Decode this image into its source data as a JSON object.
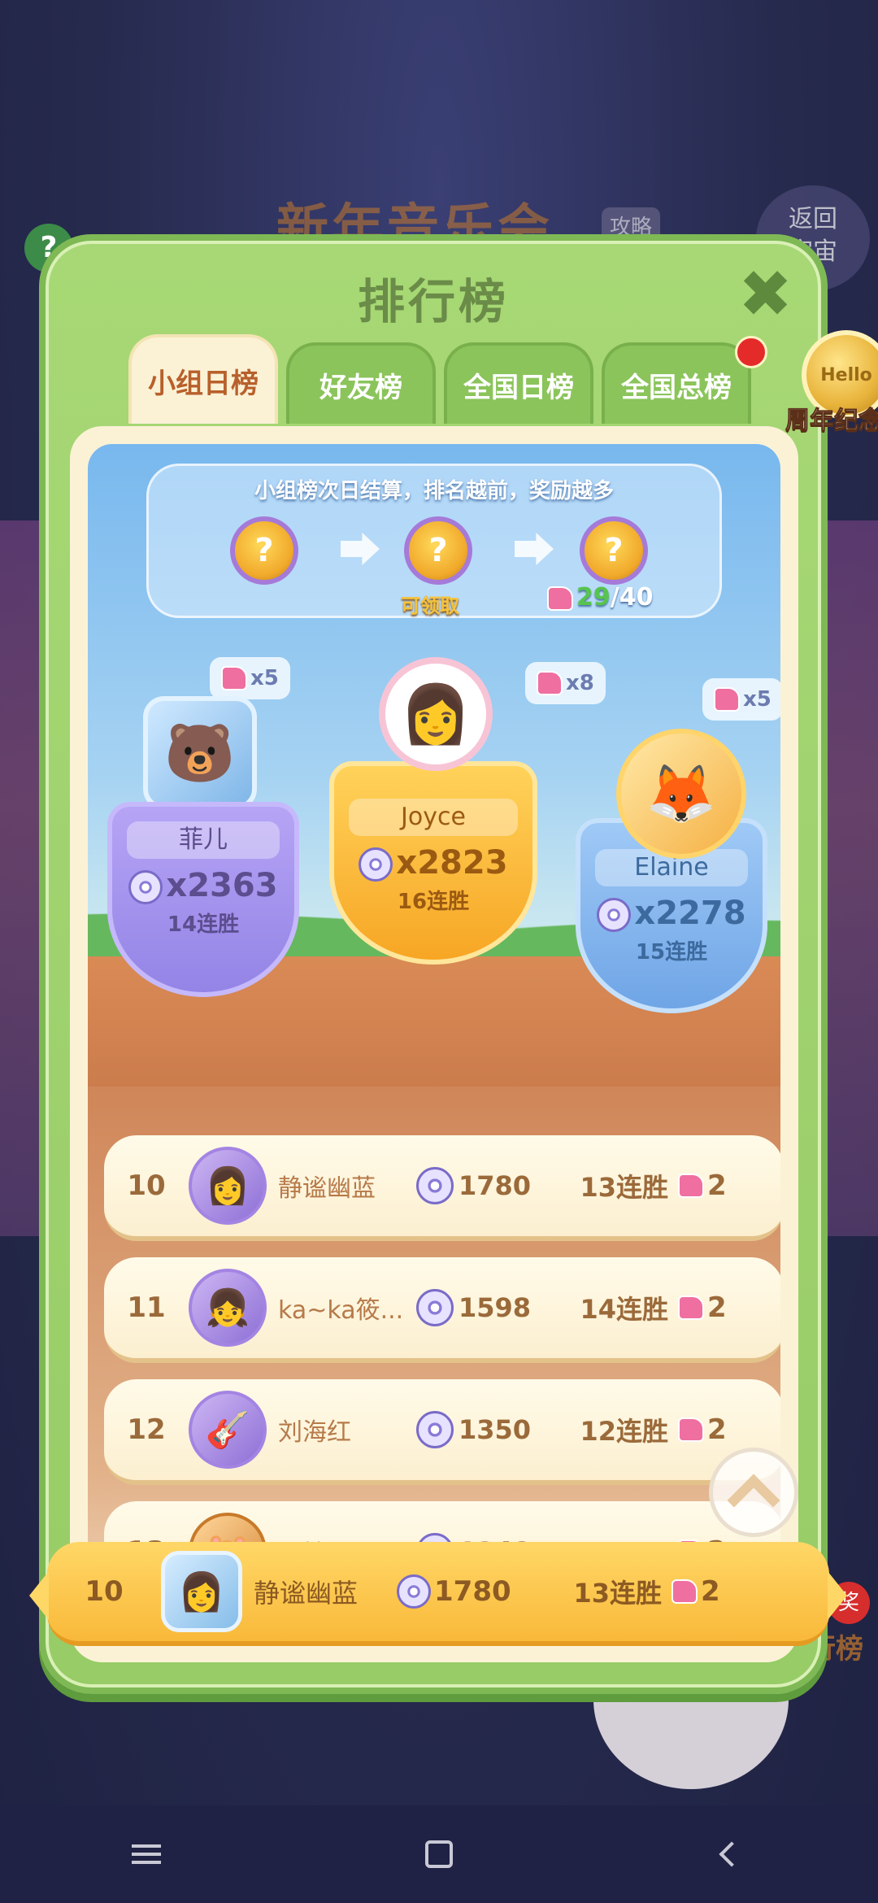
{
  "background": {
    "event_title": "新年音乐会",
    "guide_label": "攻略",
    "back_label": "返回\n宇宙",
    "help_label": "?",
    "bottom_label": "排行榜",
    "award_badge": "奖"
  },
  "modal": {
    "title": "排行榜",
    "close_label": "✖",
    "tabs": [
      {
        "label": "小组日榜",
        "active": true
      },
      {
        "label": "好友榜",
        "active": false
      },
      {
        "label": "全国日榜",
        "active": false
      },
      {
        "label": "全国总榜",
        "active": false
      }
    ],
    "anniversary_coin": {
      "label": "周年纪念币",
      "coin_text": "Hello"
    }
  },
  "banner": {
    "text": "小组榜次日结算，排名越前，奖励越多",
    "rewards": [
      "?",
      "?",
      "?"
    ],
    "claim_label": "可领取",
    "progress_current": "29",
    "progress_total": "/40"
  },
  "podium": {
    "first": {
      "name": "Joyce",
      "score": "x2823",
      "streak": "16连胜",
      "pieces": "x8"
    },
    "second": {
      "name": "菲儿",
      "score": "x2363",
      "streak": "14连胜",
      "pieces": "x5"
    },
    "third": {
      "name": "Elaine",
      "score": "x2278",
      "streak": "15连胜",
      "pieces": "x5"
    }
  },
  "list": [
    {
      "rank": "10",
      "name": "静谧幽蓝",
      "score": "1780",
      "streak": "13连胜",
      "pieces": "2"
    },
    {
      "rank": "11",
      "name": "ka~ka筱...",
      "score": "1598",
      "streak": "14连胜",
      "pieces": "2"
    },
    {
      "rank": "12",
      "name": "刘海红",
      "score": "1350",
      "streak": "12连胜",
      "pieces": "2"
    },
    {
      "rank": "13",
      "name": "雪精灵",
      "score": "1348",
      "streak": "",
      "pieces": "2"
    }
  ],
  "my_row": {
    "rank": "10",
    "name": "静谧幽蓝",
    "score": "1780",
    "streak": "13连胜",
    "pieces": "2"
  },
  "colors": {
    "modal_green": "#a7d875",
    "tab_active_text": "#b8602c",
    "gold": "#f9b93a",
    "progress_green": "#58c44e",
    "notification_red": "#e52a2a"
  },
  "icons": {
    "close": "close-icon",
    "disc": "record-disc-icon",
    "piece": "puzzle-piece-icon",
    "scroll_top": "chevron-up-icon"
  }
}
